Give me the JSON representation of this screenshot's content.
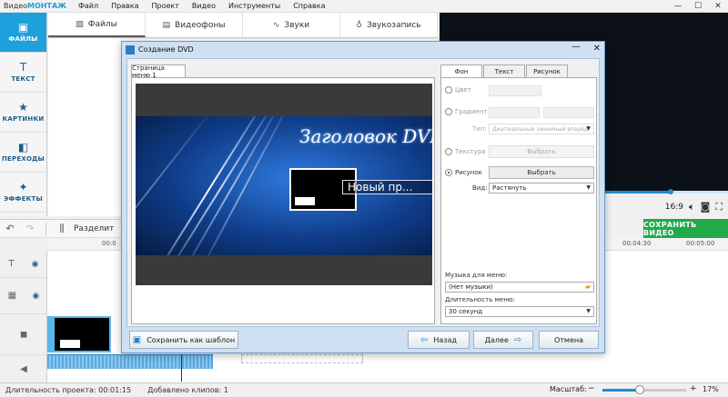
{
  "app": {
    "logo_prefix": "Видео",
    "logo_brand": "МОНТАЖ"
  },
  "menubar": [
    "Файл",
    "Правка",
    "Проект",
    "Видео",
    "Инструменты",
    "Справка"
  ],
  "window_controls": {
    "minimize": "—",
    "maximize": "☐",
    "close": "✕"
  },
  "leftnav": [
    {
      "label": "ФАЙЛЫ",
      "icon": "image-icon",
      "glyph": "▣"
    },
    {
      "label": "ТЕКСТ",
      "icon": "text-icon",
      "glyph": "T"
    },
    {
      "label": "КАРТИНКИ",
      "icon": "star-icon",
      "glyph": "★"
    },
    {
      "label": "ПЕРЕХОДЫ",
      "icon": "transitions-icon",
      "glyph": "◧"
    },
    {
      "label": "ЭФФЕКТЫ",
      "icon": "wand-icon",
      "glyph": "✦"
    }
  ],
  "toptabs": [
    {
      "label": "Файлы",
      "icon": "image-icon",
      "glyph": "▨"
    },
    {
      "label": "Видеофоны",
      "icon": "film-icon",
      "glyph": "▤"
    },
    {
      "label": "Звуки",
      "icon": "waveform-icon",
      "glyph": "∿"
    },
    {
      "label": "Звукозапись",
      "icon": "microphone-icon",
      "glyph": "♁"
    }
  ],
  "preview": {
    "progress": 0.8,
    "ratio": "16:9",
    "save_label": "СОХРАНИТЬ ВИДЕО"
  },
  "toolbar": {
    "split_label": "Разделит"
  },
  "ruler": [
    "00:0",
    "00:04:30",
    "00:05:00"
  ],
  "status": {
    "duration": "Длительность проекта:  00:01:15",
    "clips": "Добавлено клипов: 1",
    "zoom_label": "Масштаб:",
    "zoom_pct": "17%",
    "zoom_minus": "−",
    "zoom_plus": "+"
  },
  "dialog": {
    "title": "Создание DVD",
    "close": "✕",
    "minimize": "—",
    "page_tab": "Страница меню 1",
    "menu_title": "Заголовок DVD",
    "chapter_label": "Новый пр...",
    "tabs": [
      "Фон",
      "Текст",
      "Рисунок"
    ],
    "options": {
      "color": "Цвет",
      "gradient": "Градиент",
      "type_label": "Тип:",
      "type_value": "Диагональный линейный вперёд",
      "texture": "Текстура",
      "texture_btn": "Выбрать",
      "picture": "Рисунок",
      "picture_btn": "Выбрать",
      "view_label": "Вид:",
      "view_value": "Растянуть"
    },
    "music_label": "Музыка для меню:",
    "music_value": "(Нет музыки)",
    "duration_label": "Длительность меню:",
    "duration_value": "30 секунд",
    "save_template": "Сохранить как шаблон",
    "back": "Назад",
    "next": "Далее",
    "cancel": "Отмена"
  }
}
